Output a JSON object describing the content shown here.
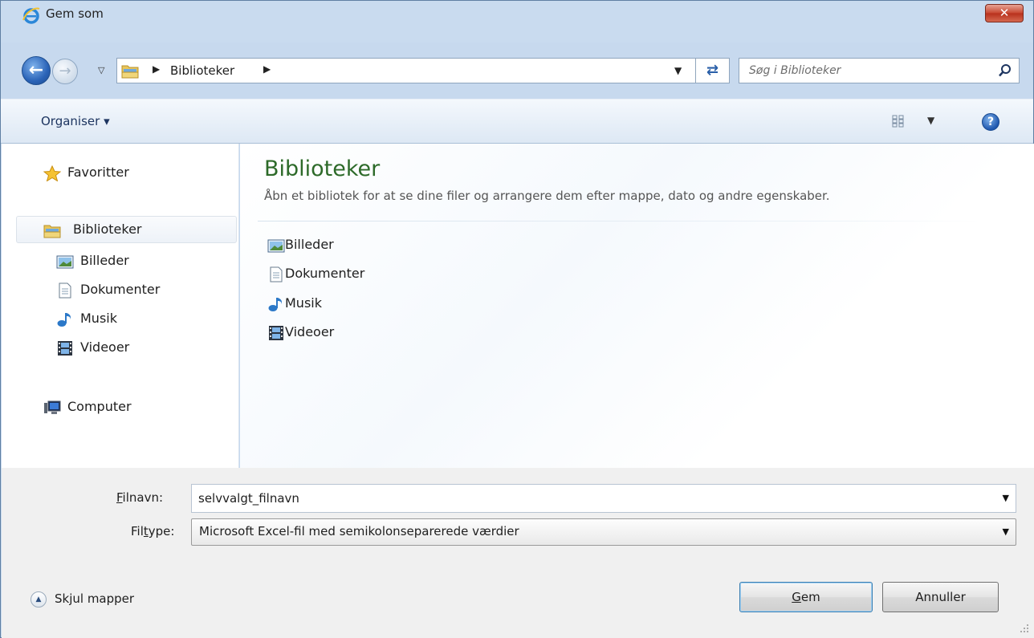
{
  "window": {
    "title": "Gem som",
    "close_label": "✕"
  },
  "nav": {
    "back_glyph": "←",
    "forward_glyph": "→",
    "address": {
      "crumb": "Biblioteker"
    },
    "search_placeholder": "Søg i Biblioteker",
    "refresh_glyph": "⇄"
  },
  "toolbar": {
    "organise_label": "Organiser ▾",
    "help_glyph": "?"
  },
  "sidebar": {
    "favorites": {
      "label": "Favoritter",
      "icon": "star-icon"
    },
    "libraries": {
      "label": "Biblioteker",
      "icon": "libraries-folder-icon"
    },
    "library_items": [
      {
        "label": "Billeder",
        "icon": "pictures-icon"
      },
      {
        "label": "Dokumenter",
        "icon": "document-icon"
      },
      {
        "label": "Musik",
        "icon": "music-note-icon"
      },
      {
        "label": "Videoer",
        "icon": "film-icon"
      }
    ],
    "computer": {
      "label": "Computer",
      "icon": "computer-icon"
    }
  },
  "content": {
    "title": "Biblioteker",
    "subtitle": "Åbn et bibliotek for at se dine filer og arrangere dem efter mappe, dato og andre egenskaber.",
    "items": [
      {
        "label": "Billeder",
        "icon": "pictures-icon"
      },
      {
        "label": "Dokumenter",
        "icon": "document-icon"
      },
      {
        "label": "Musik",
        "icon": "music-note-icon"
      },
      {
        "label": "Videoer",
        "icon": "film-icon"
      }
    ]
  },
  "form": {
    "filename_label_accel": "F",
    "filename_label_rest": "ilnavn:",
    "filename_value": "selvvalgt_filnavn",
    "filetype_label_pre": "Fil",
    "filetype_label_accel": "t",
    "filetype_label_rest": "ype:",
    "filetype_value": "Microsoft Excel-fil med semikolonseparerede værdier"
  },
  "footer": {
    "hide_folders_label": "Skjul mapper",
    "save_label_accel": "G",
    "save_label_rest": "em",
    "cancel_label": "Annuller"
  },
  "colors": {
    "title_green": "#2d6a29",
    "window_frame": "#c7d9ee",
    "close_red": "#c7452f"
  }
}
